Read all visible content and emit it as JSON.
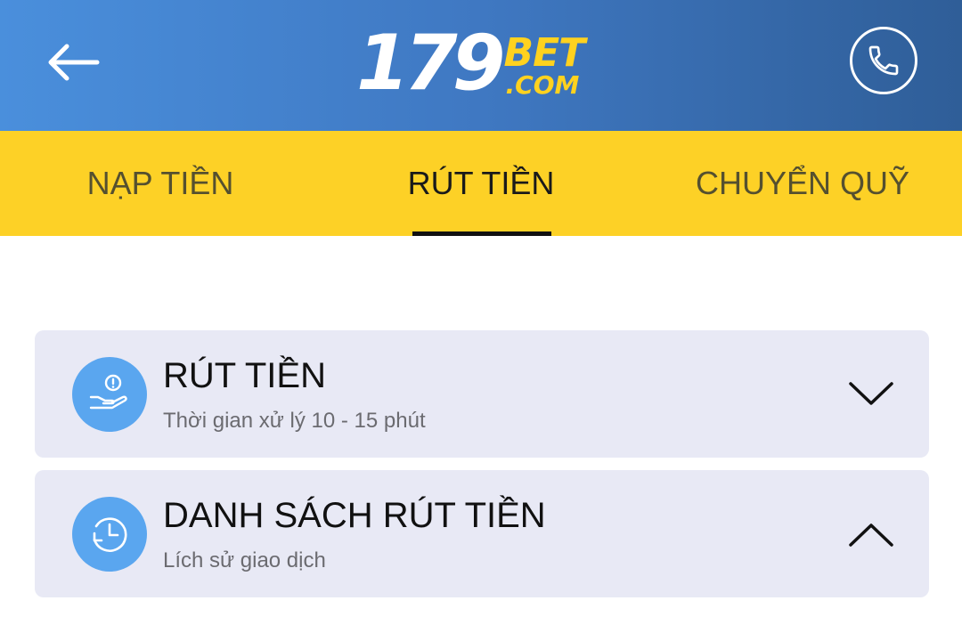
{
  "header": {
    "back_icon": "arrow-left-icon",
    "logo": {
      "number": "179",
      "brand": "BET",
      "suffix": ".COM"
    },
    "phone_icon": "phone-icon",
    "bg_color": "#3f78c2",
    "brand_color": "#ffd21f"
  },
  "tabs": [
    {
      "label": "NẠP TIỀN",
      "active": false
    },
    {
      "label": "RÚT TIỀN",
      "active": true
    },
    {
      "label": "CHUYỂN QUỸ",
      "active": false
    }
  ],
  "tab_bar_color": "#fdd126",
  "sections": [
    {
      "title": "RÚT TIỀN",
      "subtitle": "Thời gian xử lý 10 - 15 phút",
      "icon": "hand-coin-icon",
      "chevron": "chevron-down-icon"
    },
    {
      "title": "DANH SÁCH RÚT TIỀN",
      "subtitle": "Lích sử giao dịch",
      "icon": "history-clock-icon",
      "chevron": "chevron-up-icon"
    }
  ]
}
